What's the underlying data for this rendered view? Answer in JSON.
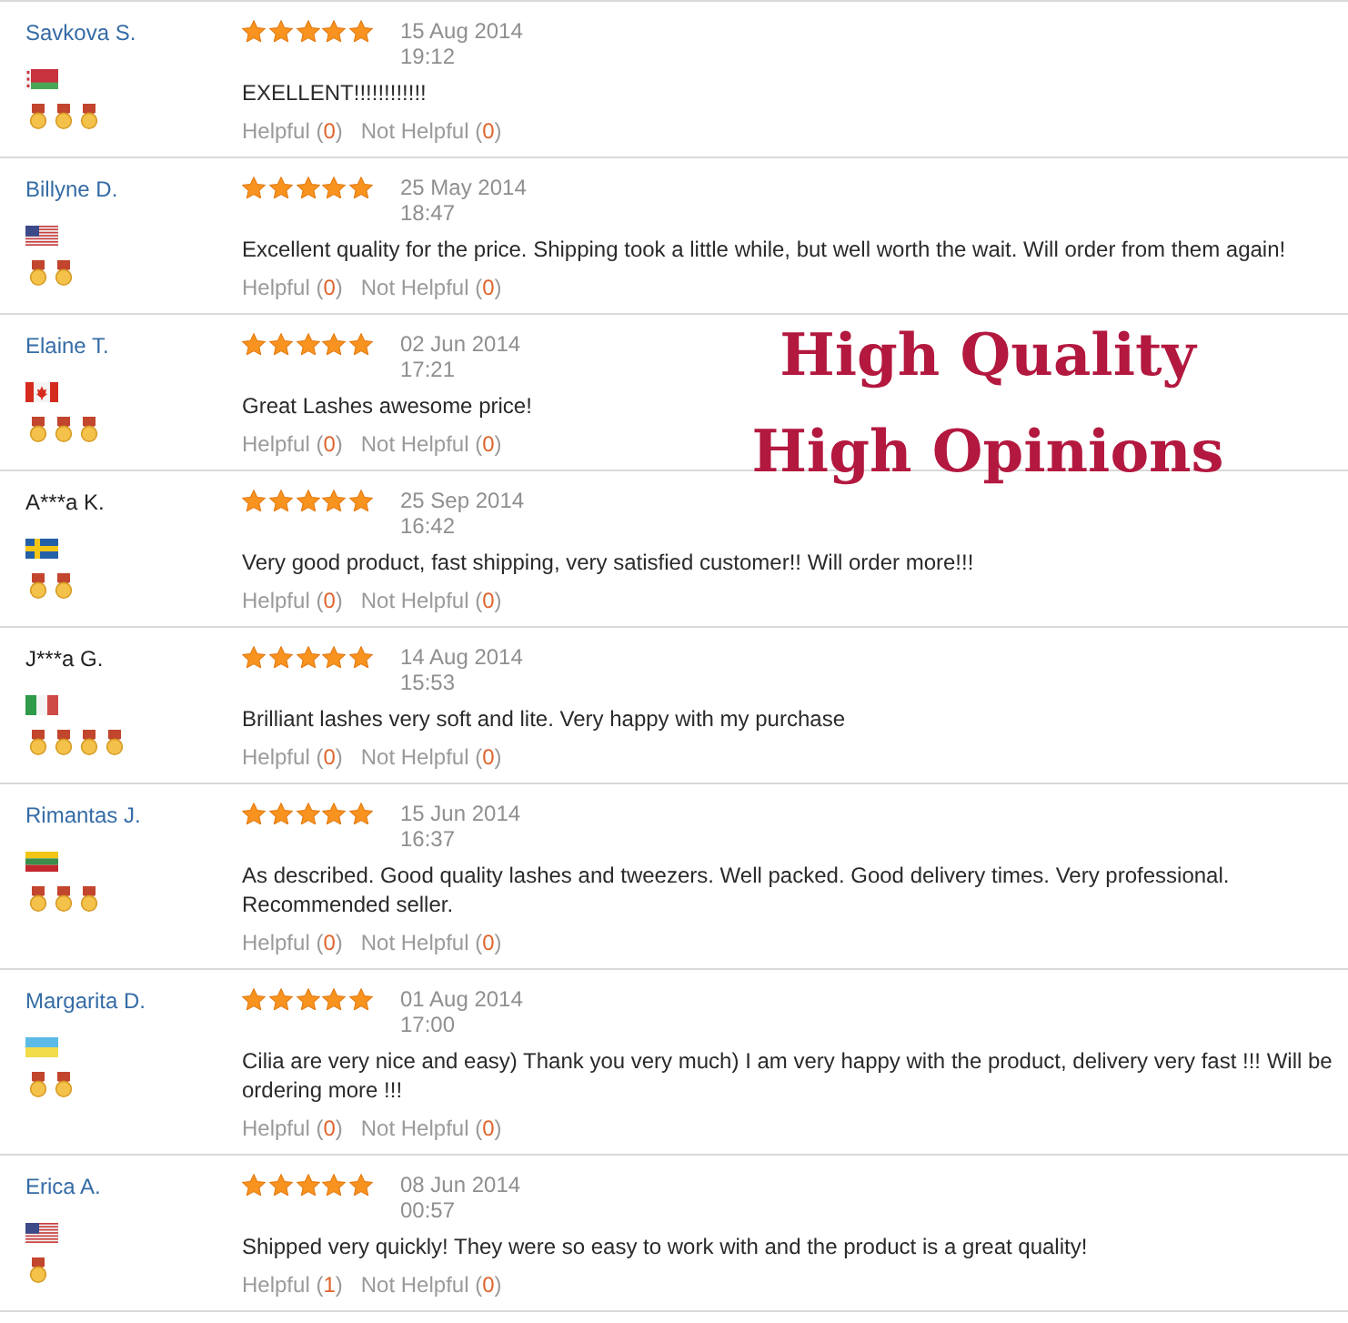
{
  "reviews": [
    {
      "name": "Savkova S.",
      "linked": true,
      "flag": {
        "kind": "belarus"
      },
      "medals": [
        {
          "kind": "medal"
        },
        {
          "kind": "medal"
        },
        {
          "kind": "medal"
        }
      ],
      "stars": 5,
      "date": "15 Aug 2014",
      "time": "19:12",
      "text": "EXELLENT!!!!!!!!!!!!",
      "votes": [
        {
          "label": "Helpful (",
          "count": "0",
          "close": ")"
        },
        {
          "label": "Not Helpful (",
          "count": "0",
          "close": ")"
        }
      ]
    },
    {
      "name": "Billyne D.",
      "linked": true,
      "flag": {
        "kind": "usa"
      },
      "medals": [
        {
          "kind": "medal"
        },
        {
          "kind": "medal"
        }
      ],
      "stars": 5,
      "date": "25 May 2014",
      "time": "18:47",
      "text": "Excellent quality for the price. Shipping took a little while, but well worth the wait. Will order from them again!",
      "votes": [
        {
          "label": "Helpful (",
          "count": "0",
          "close": ")"
        },
        {
          "label": "Not Helpful (",
          "count": "0",
          "close": ")"
        }
      ]
    },
    {
      "name": "Elaine T.",
      "linked": true,
      "flag": {
        "kind": "canada"
      },
      "medals": [
        {
          "kind": "medal"
        },
        {
          "kind": "medal"
        },
        {
          "kind": "medal"
        }
      ],
      "stars": 5,
      "date": "02 Jun 2014",
      "time": "17:21",
      "text": "Great Lashes awesome price!",
      "votes": [
        {
          "label": "Helpful (",
          "count": "0",
          "close": ")"
        },
        {
          "label": "Not Helpful (",
          "count": "0",
          "close": ")"
        }
      ]
    },
    {
      "name": "A***a K.",
      "linked": false,
      "flag": {
        "kind": "sweden"
      },
      "medals": [
        {
          "kind": "medal"
        },
        {
          "kind": "medal"
        }
      ],
      "stars": 5,
      "date": "25 Sep 2014",
      "time": "16:42",
      "text": "Very good product, fast shipping, very satisfied customer!! Will order more!!!",
      "votes": [
        {
          "label": "Helpful (",
          "count": "0",
          "close": ")"
        },
        {
          "label": "Not Helpful (",
          "count": "0",
          "close": ")"
        }
      ]
    },
    {
      "name": "J***a G.",
      "linked": false,
      "flag": {
        "kind": "italy"
      },
      "medals": [
        {
          "kind": "medal"
        },
        {
          "kind": "medal"
        },
        {
          "kind": "medal"
        },
        {
          "kind": "medal"
        }
      ],
      "stars": 5,
      "date": "14 Aug 2014",
      "time": "15:53",
      "text": "Brilliant lashes very soft and lite. Very happy with my purchase",
      "votes": [
        {
          "label": "Helpful (",
          "count": "0",
          "close": ")"
        },
        {
          "label": "Not Helpful (",
          "count": "0",
          "close": ")"
        }
      ]
    },
    {
      "name": "Rimantas J.",
      "linked": true,
      "flag": {
        "kind": "lithuania"
      },
      "medals": [
        {
          "kind": "medal"
        },
        {
          "kind": "medal"
        },
        {
          "kind": "medal"
        }
      ],
      "stars": 5,
      "date": "15 Jun 2014",
      "time": "16:37",
      "text": "As described. Good quality lashes and tweezers. Well packed. Good delivery times. Very professional. Recommended seller.",
      "votes": [
        {
          "label": "Helpful (",
          "count": "0",
          "close": ")"
        },
        {
          "label": "Not Helpful (",
          "count": "0",
          "close": ")"
        }
      ]
    },
    {
      "name": "Margarita D.",
      "linked": true,
      "flag": {
        "kind": "ukraine"
      },
      "medals": [
        {
          "kind": "medal"
        },
        {
          "kind": "medal"
        }
      ],
      "stars": 5,
      "date": "01 Aug 2014",
      "time": "17:00",
      "text": "Cilia are very nice and easy) Thank you very much) I am very happy with the product, delivery very fast !!! Will be ordering more !!!",
      "votes": [
        {
          "label": "Helpful (",
          "count": "0",
          "close": ")"
        },
        {
          "label": "Not Helpful (",
          "count": "0",
          "close": ")"
        }
      ]
    },
    {
      "name": "Erica A.",
      "linked": true,
      "flag": {
        "kind": "usa"
      },
      "medals": [
        {
          "kind": "medal"
        }
      ],
      "stars": 5,
      "date": "08 Jun 2014",
      "time": "00:57",
      "text": "Shipped very quickly! They were so easy to work with and the product is a great quality!",
      "votes": [
        {
          "label": "Helpful (",
          "count": "1",
          "close": ")"
        },
        {
          "label": "Not Helpful (",
          "count": "0",
          "close": ")"
        }
      ]
    }
  ],
  "banner": {
    "lines": [
      "High Quality",
      "High Opinions"
    ]
  }
}
